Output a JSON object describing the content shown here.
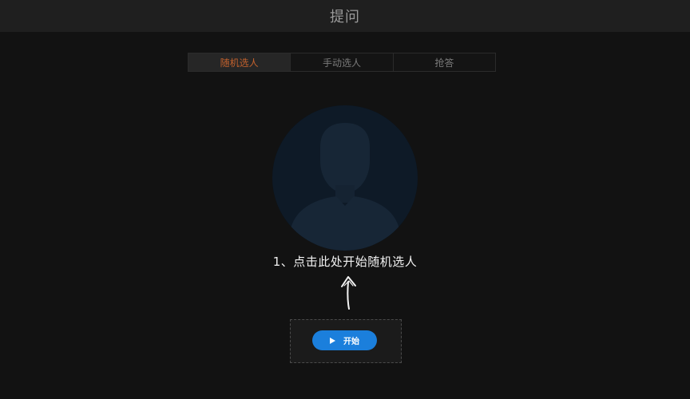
{
  "header": {
    "title": "提问"
  },
  "tabs": [
    {
      "label": "随机选人",
      "active": true
    },
    {
      "label": "手动选人",
      "active": false
    },
    {
      "label": "抢答",
      "active": false
    }
  ],
  "instruction": "1、点击此处开始随机选人",
  "start_button": {
    "label": "开始",
    "icon": "play-icon"
  },
  "colors": {
    "accent": "#c4622d",
    "button": "#1b7fdc",
    "avatar_bg": "#0e1a27"
  }
}
